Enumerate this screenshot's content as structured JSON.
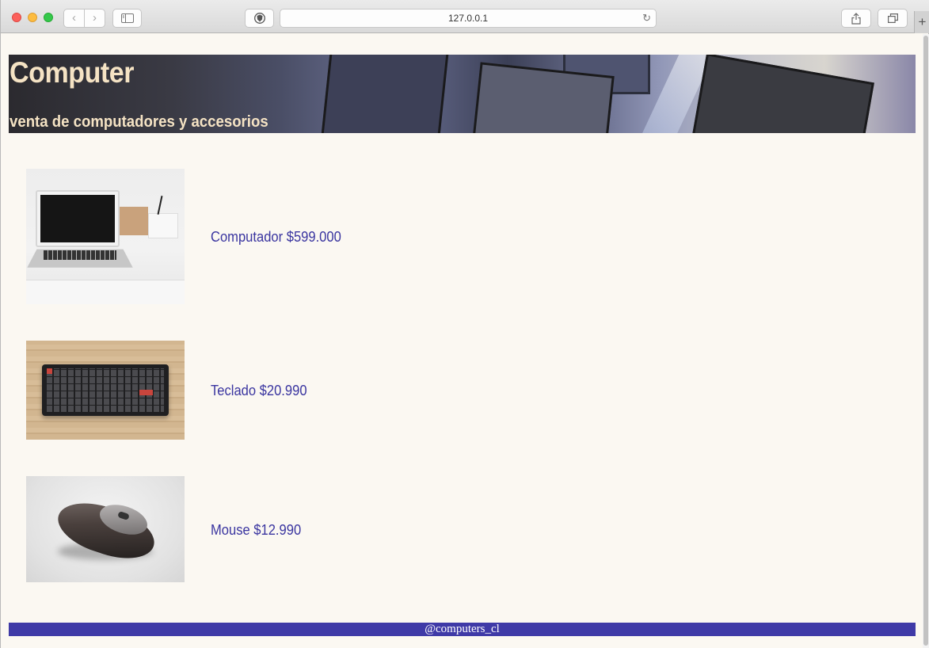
{
  "browser": {
    "url": "127.0.0.1",
    "nav_back_glyph": "‹",
    "nav_forward_glyph": "›",
    "new_tab_glyph": "+",
    "reload_glyph": "↻"
  },
  "header": {
    "title": "Computer",
    "subtitle": "venta de computadores y accesorios"
  },
  "products": [
    {
      "label": "Computador $599.000",
      "image": "laptop-image"
    },
    {
      "label": "Teclado $20.990",
      "image": "keyboard-image"
    },
    {
      "label": "Mouse $12.990",
      "image": "mouse-image"
    }
  ],
  "footer": {
    "text": "@computers_cl"
  },
  "colors": {
    "page_background": "#fbf8f2",
    "banner_text": "#f5e3c4",
    "product_text": "#3a35a0",
    "footer_background": "#3f3aa7",
    "footer_text": "#ffffff"
  }
}
